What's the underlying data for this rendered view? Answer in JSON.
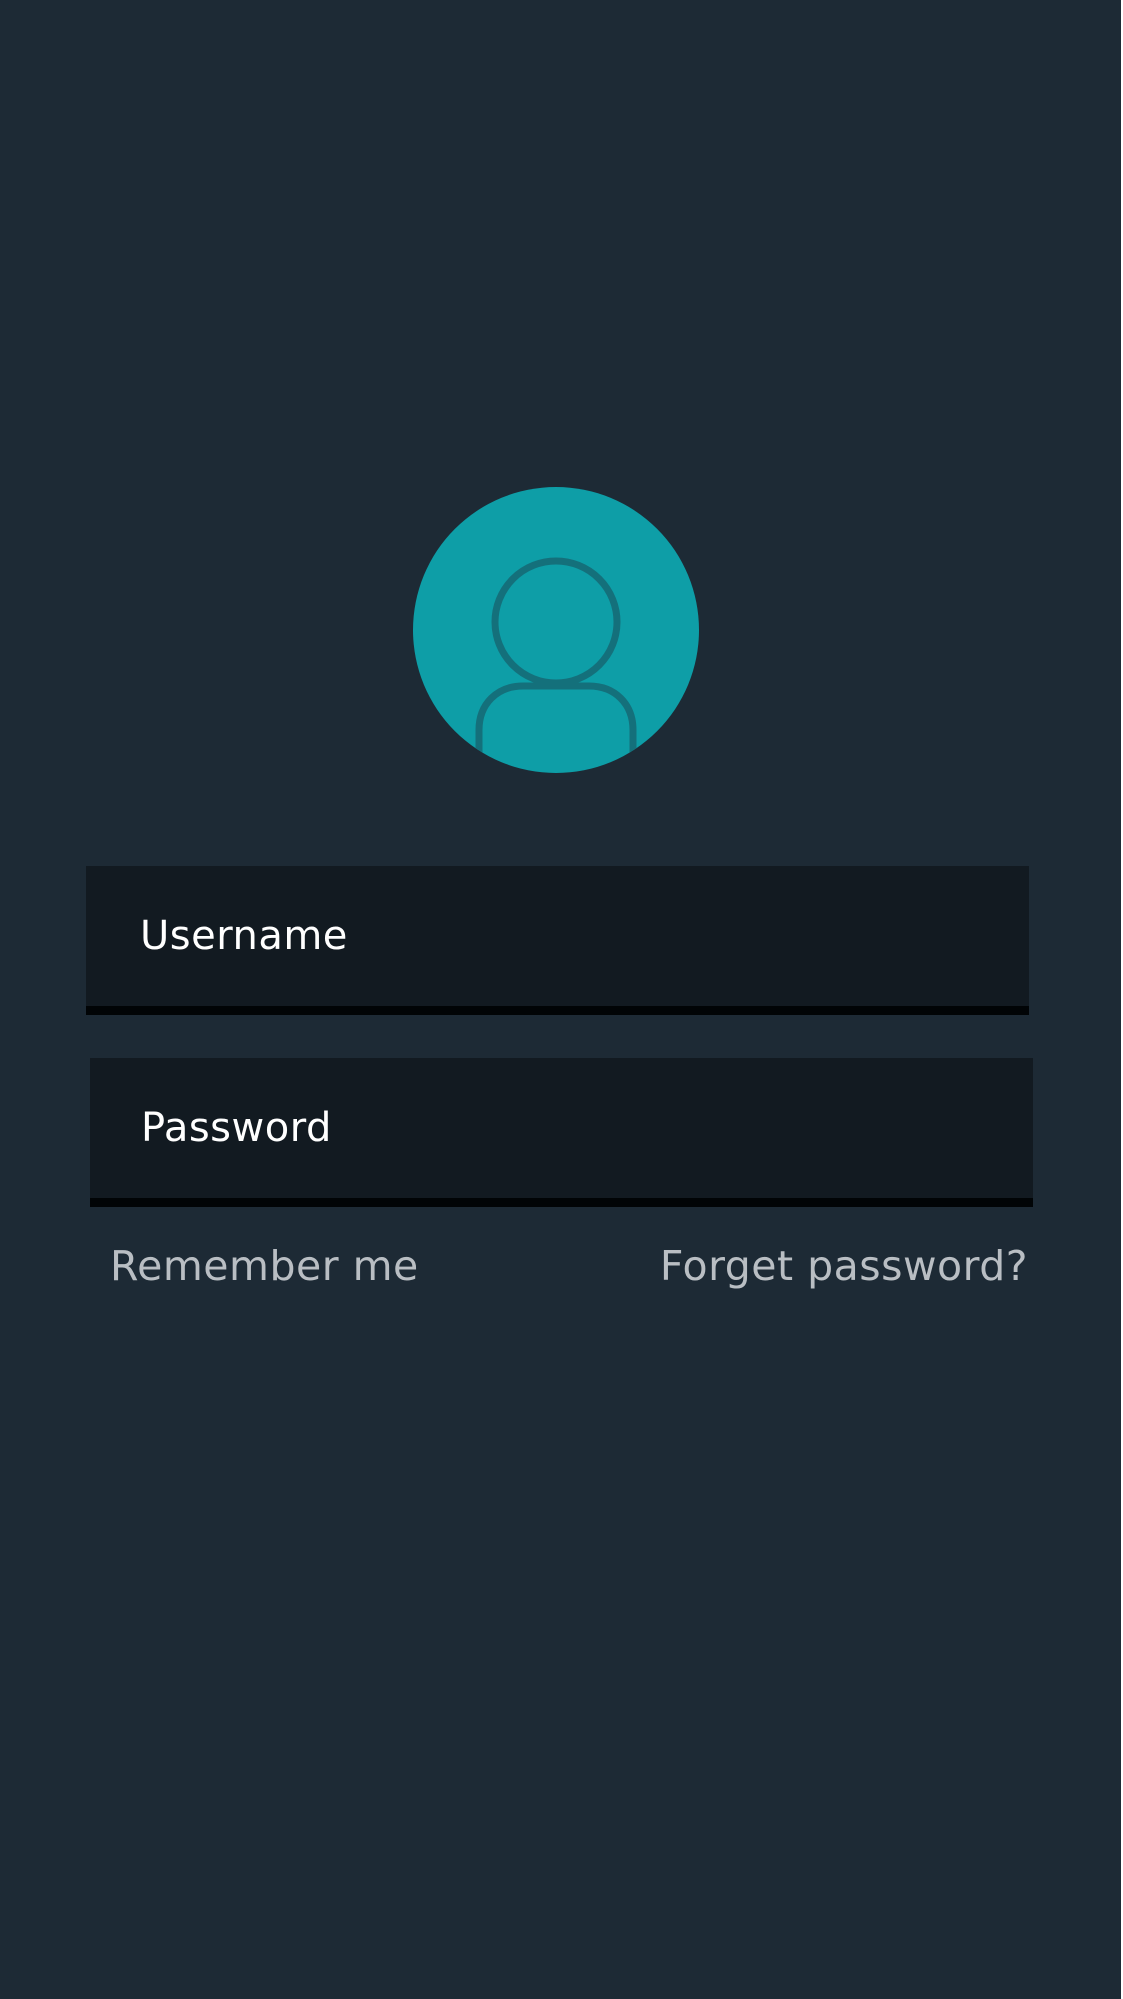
{
  "login": {
    "avatar_icon": "user-icon",
    "username": {
      "placeholder": "Username",
      "value": ""
    },
    "password": {
      "placeholder": "Password",
      "value": ""
    },
    "remember_label": "Remember me",
    "forgot_label": "Forget password?"
  },
  "colors": {
    "background": "#1d2a35",
    "accent": "#0e9ea7",
    "field_background": "#121a21",
    "field_underline": "#010406",
    "secondary_text": "#b9bec3"
  }
}
